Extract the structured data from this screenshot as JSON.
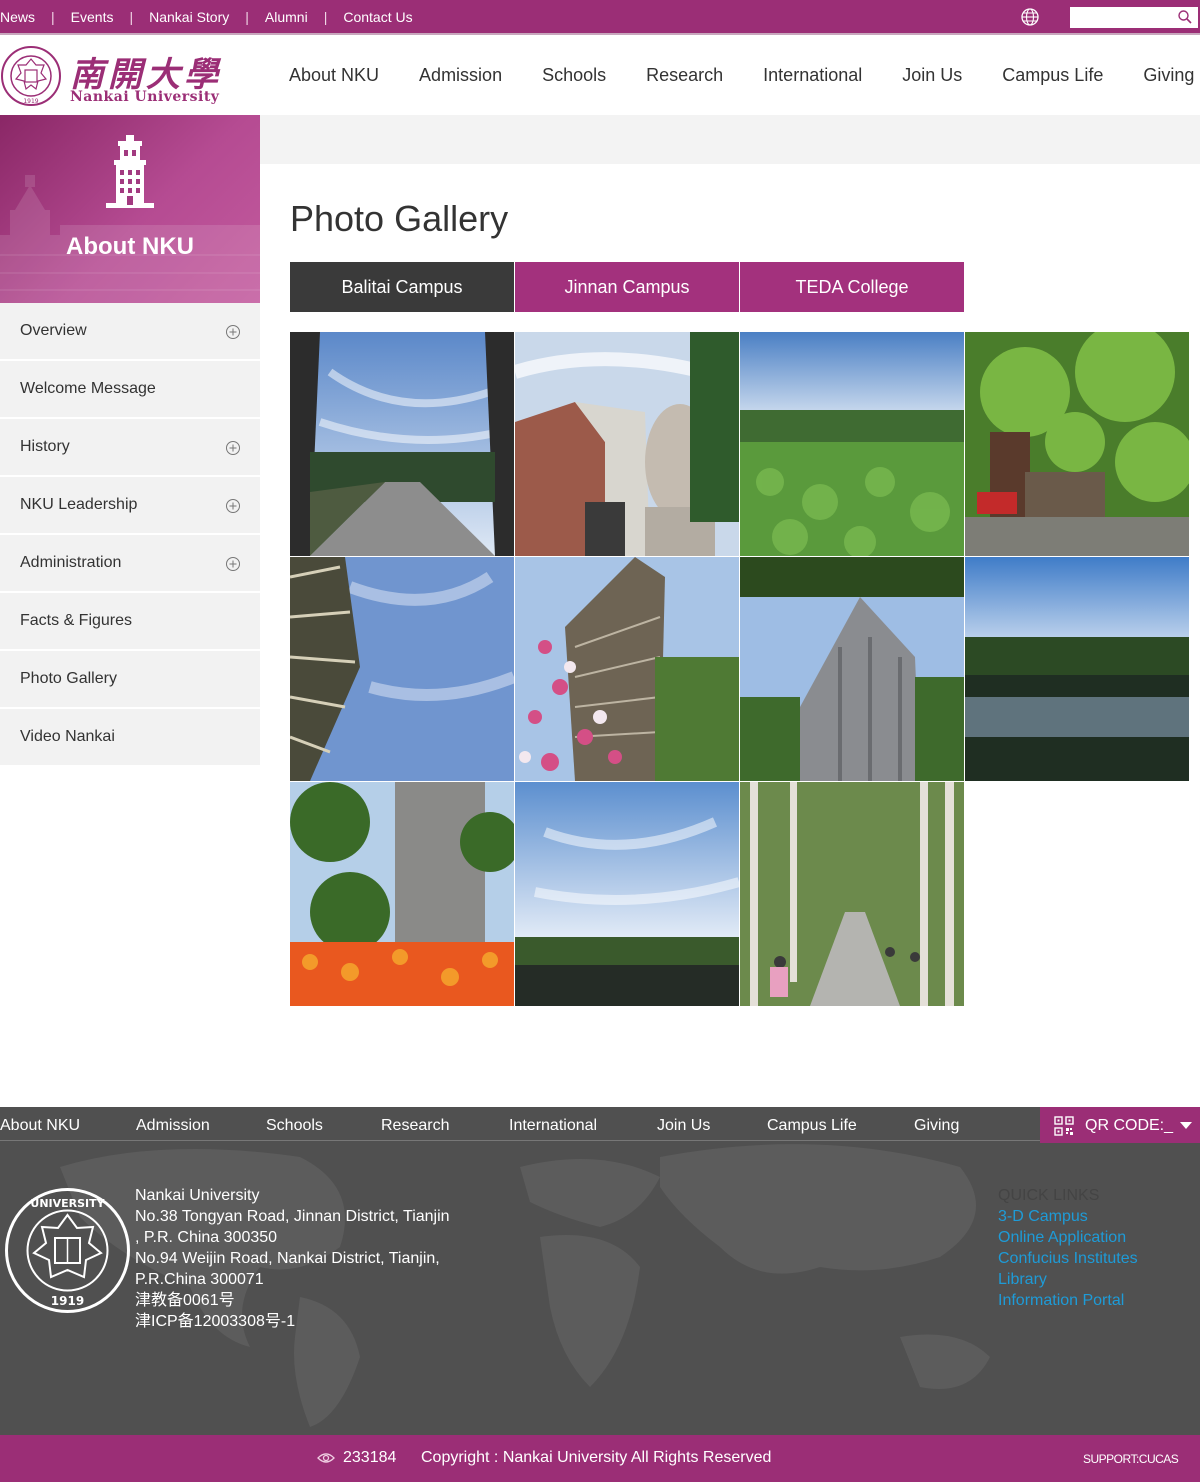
{
  "topbar": {
    "links": [
      "News",
      "Events",
      "Nankai Story",
      "Alumni",
      "Contact Us"
    ],
    "search_placeholder": ""
  },
  "brand": {
    "name_cn": "南開大學",
    "name_en": "Nankai University",
    "color": "#9b2e76"
  },
  "mainnav": [
    "About NKU",
    "Admission",
    "Schools",
    "Research",
    "International",
    "Join Us",
    "Campus Life",
    "Giving"
  ],
  "sidebar": {
    "title": "About NKU",
    "items": [
      {
        "label": "Overview",
        "expandable": true
      },
      {
        "label": "Welcome Message",
        "expandable": false
      },
      {
        "label": "History",
        "expandable": true
      },
      {
        "label": "NKU Leadership",
        "expandable": true
      },
      {
        "label": "Administration",
        "expandable": true
      },
      {
        "label": "Facts & Figures",
        "expandable": false
      },
      {
        "label": "Photo Gallery",
        "expandable": false
      },
      {
        "label": "Video Nankai",
        "expandable": false
      }
    ]
  },
  "main": {
    "title": "Photo Gallery",
    "tabs": [
      {
        "label": "Balitai Campus",
        "active": true
      },
      {
        "label": "Jinnan Campus",
        "active": false
      },
      {
        "label": "TEDA College",
        "active": false
      }
    ],
    "photo_count": 11
  },
  "footer": {
    "nav": [
      "About NKU",
      "Admission",
      "Schools",
      "Research",
      "International",
      "Join Us",
      "Campus Life",
      "Giving"
    ],
    "qr_label": "QR CODE:_",
    "address_lines": [
      "Nankai University",
      "No.38 Tongyan Road, Jinnan District, Tianjin",
      ", P.R. China 300350",
      "No.94 Weijin Road,  Nankai District, Tianjin,",
      "P.R.China  300071",
      "津教备0061号",
      "津ICP备12003308号-1"
    ],
    "quick_links_title": "QUICK LINKS",
    "quick_links": [
      "3-D Campus",
      "Online Application",
      "Confucius Institutes",
      "Library",
      "Information Portal"
    ],
    "link_color": "#1e9bd7"
  },
  "bottombar": {
    "visit_count": "233184",
    "copyright": "Copyright : Nankai University All Rights Reserved",
    "support": "SUPPORT:CUCAS"
  }
}
